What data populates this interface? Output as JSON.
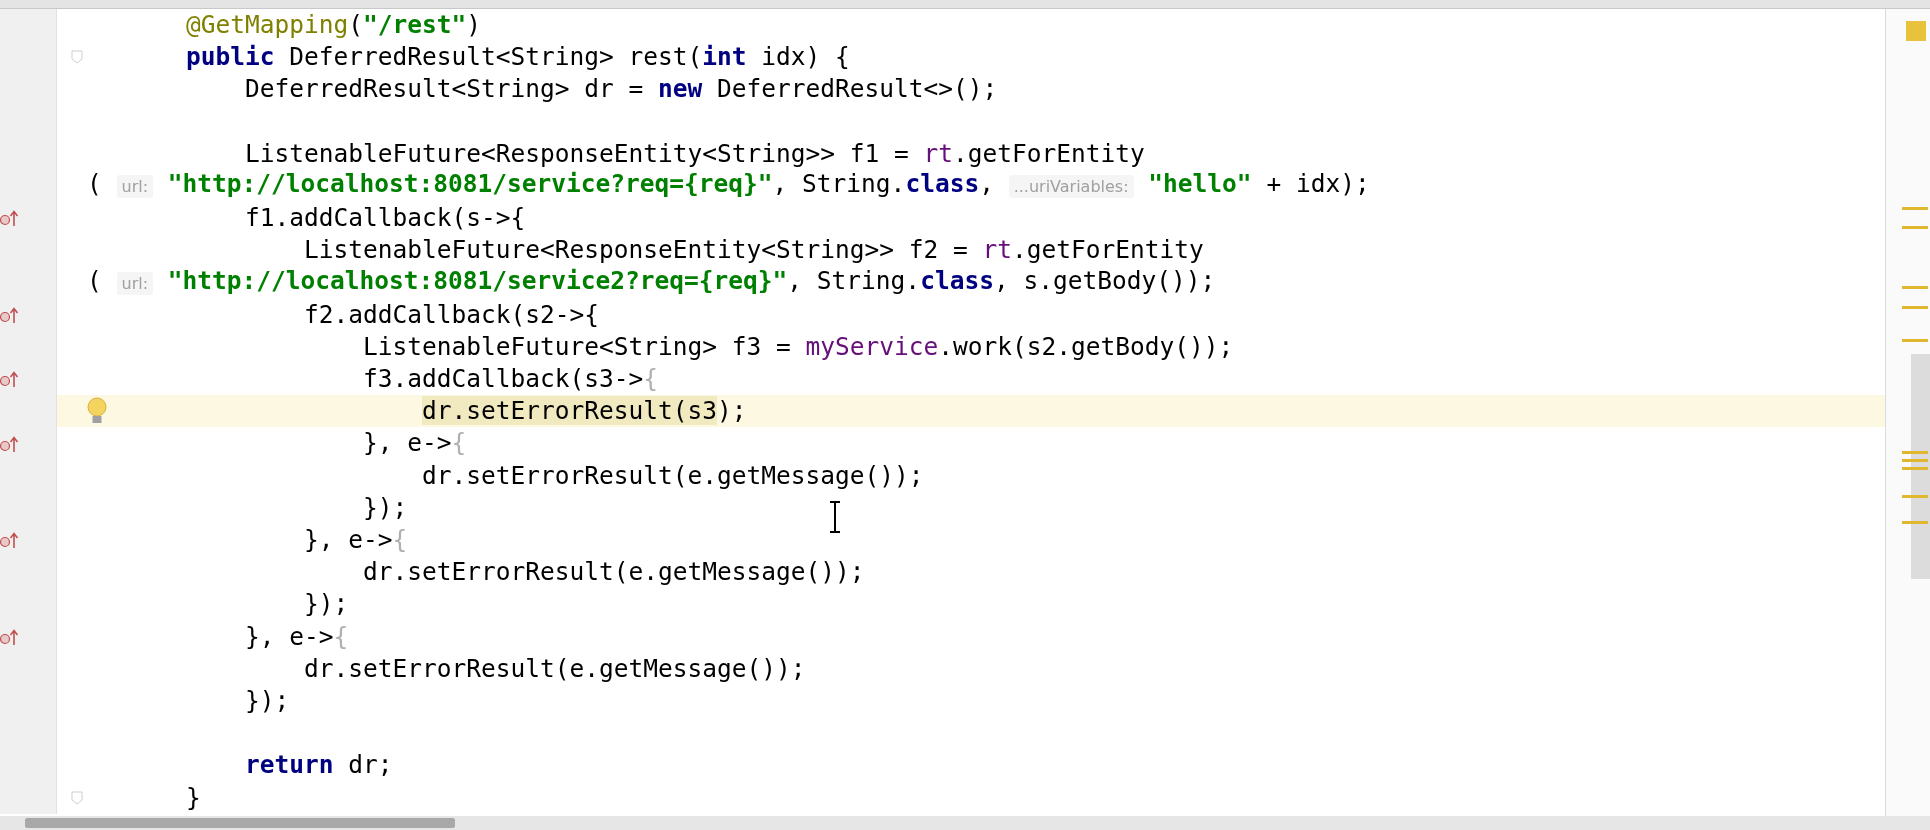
{
  "editor": {
    "lines": [
      {
        "kind": "code",
        "tokens": [
          {
            "t": "    @GetMapping",
            "kind": "annotation"
          },
          {
            "t": "(",
            "kind": "plain"
          },
          {
            "t": "\"/rest\"",
            "kind": "string"
          },
          {
            "t": ")",
            "kind": "plain"
          }
        ]
      },
      {
        "kind": "code",
        "fold": true,
        "tokens": [
          {
            "t": "    public",
            "kind": "keyword"
          },
          {
            "t": " DeferredResult<String> rest(",
            "kind": "plain"
          },
          {
            "t": "int",
            "kind": "keyword"
          },
          {
            "t": " idx) {",
            "kind": "plain"
          }
        ]
      },
      {
        "kind": "code",
        "tokens": [
          {
            "t": "        DeferredResult<String> dr = ",
            "kind": "plain"
          },
          {
            "t": "new",
            "kind": "keyword"
          },
          {
            "t": " DeferredResult<>();",
            "kind": "plain"
          }
        ]
      },
      {
        "kind": "blank"
      },
      {
        "kind": "code",
        "tokens": [
          {
            "t": "        ListenableFuture<ResponseEntity<String>> f1 = ",
            "kind": "plain"
          },
          {
            "t": "rt",
            "kind": "field"
          },
          {
            "t": ".getForEntity",
            "kind": "plain"
          }
        ]
      },
      {
        "kind": "wrap",
        "tokens": [
          {
            "t": "( ",
            "kind": "plain"
          },
          {
            "t": "url:",
            "kind": "hint"
          },
          {
            "t": " \"http://localhost:8081/service?req={req}\"",
            "kind": "string"
          },
          {
            "t": ", String.",
            "kind": "plain"
          },
          {
            "t": "class",
            "kind": "keyword"
          },
          {
            "t": ", ",
            "kind": "plain"
          },
          {
            "t": "...uriVariables:",
            "kind": "hint"
          },
          {
            "t": " \"hello\"",
            "kind": "string"
          },
          {
            "t": " + idx);",
            "kind": "plain"
          }
        ]
      },
      {
        "kind": "code",
        "lambda_marker": true,
        "tokens": [
          {
            "t": "        f1.addCallback(s->{",
            "kind": "plain"
          }
        ]
      },
      {
        "kind": "code",
        "tokens": [
          {
            "t": "            ListenableFuture<ResponseEntity<String>> f2 = ",
            "kind": "plain"
          },
          {
            "t": "rt",
            "kind": "field"
          },
          {
            "t": ".getForEntity",
            "kind": "plain"
          }
        ]
      },
      {
        "kind": "wrap",
        "tokens": [
          {
            "t": "( ",
            "kind": "plain"
          },
          {
            "t": "url:",
            "kind": "hint"
          },
          {
            "t": " \"http://localhost:8081/service2?req={req}\"",
            "kind": "string"
          },
          {
            "t": ", String.",
            "kind": "plain"
          },
          {
            "t": "class",
            "kind": "keyword"
          },
          {
            "t": ", s.getBody());",
            "kind": "plain"
          }
        ]
      },
      {
        "kind": "code",
        "lambda_marker": true,
        "tokens": [
          {
            "t": "            f2.addCallback(s2->{",
            "kind": "plain"
          }
        ]
      },
      {
        "kind": "code",
        "tokens": [
          {
            "t": "                ListenableFuture<String> f3 = ",
            "kind": "plain"
          },
          {
            "t": "myService",
            "kind": "field"
          },
          {
            "t": ".work(s2.getBody());",
            "kind": "plain"
          }
        ]
      },
      {
        "kind": "code",
        "lambda_marker": true,
        "tokens": [
          {
            "t": "                f3.addCallback(s3->",
            "kind": "plain"
          },
          {
            "t": "{",
            "kind": "dim"
          }
        ]
      },
      {
        "kind": "code",
        "current": true,
        "bulb": true,
        "tokens": [
          {
            "t": "                    dr.setErrorResult(s3",
            "kind": "highlight"
          },
          {
            "t": ");",
            "kind": "plain"
          }
        ]
      },
      {
        "kind": "code",
        "lambda_marker": true,
        "tokens": [
          {
            "t": "                }, e->",
            "kind": "plain"
          },
          {
            "t": "{",
            "kind": "dim"
          }
        ]
      },
      {
        "kind": "code",
        "tokens": [
          {
            "t": "                    dr.setErrorResult(e.getMessage());",
            "kind": "plain"
          }
        ]
      },
      {
        "kind": "code",
        "tokens": [
          {
            "t": "                });",
            "kind": "plain"
          }
        ]
      },
      {
        "kind": "code",
        "lambda_marker": true,
        "tokens": [
          {
            "t": "            }, e->",
            "kind": "plain"
          },
          {
            "t": "{",
            "kind": "dim"
          }
        ]
      },
      {
        "kind": "code",
        "tokens": [
          {
            "t": "                dr.setErrorResult(e.getMessage());",
            "kind": "plain"
          }
        ]
      },
      {
        "kind": "code",
        "tokens": [
          {
            "t": "            });",
            "kind": "plain"
          }
        ]
      },
      {
        "kind": "code",
        "lambda_marker": true,
        "tokens": [
          {
            "t": "        }, e->",
            "kind": "plain"
          },
          {
            "t": "{",
            "kind": "dim"
          }
        ]
      },
      {
        "kind": "code",
        "tokens": [
          {
            "t": "            dr.setErrorResult(e.getMessage());",
            "kind": "plain"
          }
        ]
      },
      {
        "kind": "code",
        "tokens": [
          {
            "t": "        });",
            "kind": "plain"
          }
        ]
      },
      {
        "kind": "blank"
      },
      {
        "kind": "code",
        "tokens": [
          {
            "t": "        return",
            "kind": "keyword"
          },
          {
            "t": " dr;",
            "kind": "plain"
          }
        ]
      },
      {
        "kind": "code",
        "fold": true,
        "tokens": [
          {
            "t": "    }",
            "kind": "plain"
          }
        ]
      }
    ]
  }
}
